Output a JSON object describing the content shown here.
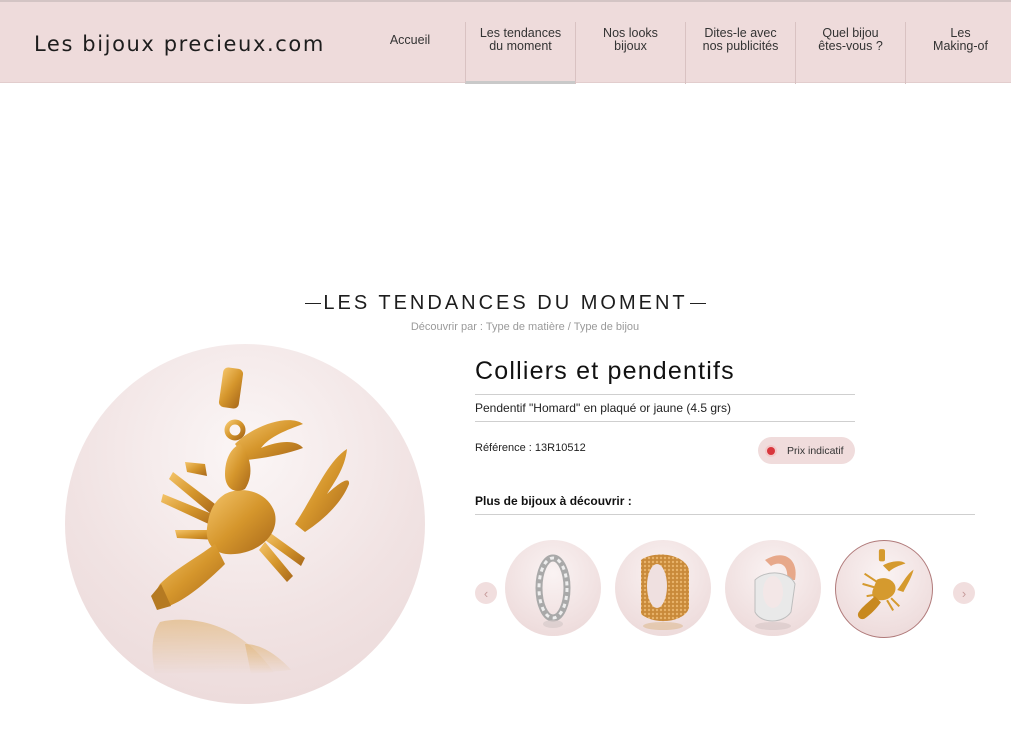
{
  "header": {
    "logo": "Les bijoux precieux.com",
    "nav": [
      {
        "line1": "Accueil",
        "line2": ""
      },
      {
        "line1": "Les tendances",
        "line2": "du moment"
      },
      {
        "line1": "Nos looks",
        "line2": "bijoux"
      },
      {
        "line1": "Dites-le avec",
        "line2": "nos publicités"
      },
      {
        "line1": "Quel bijou",
        "line2": "êtes-vous ?"
      },
      {
        "line1": "Les",
        "line2": "Making-of"
      }
    ]
  },
  "section": {
    "title": "LES TENDANCES DU MOMENT",
    "filter_prefix": "Découvrir par : ",
    "filter_material": "Type de matière",
    "filter_separator": " / ",
    "filter_type": "Type de bijou"
  },
  "product": {
    "category": "Colliers et pendentifs",
    "description": "Pendentif \"Homard\" en plaqué or jaune (4.5 grs)",
    "reference": "Référence : 13R10512",
    "price_button": "Prix indicatif"
  },
  "more": {
    "label": "Plus de bijoux à découvrir :",
    "prev_icon": "chevron-left-icon",
    "next_icon": "chevron-right-icon",
    "prev_glyph": "‹",
    "next_glyph": "›"
  },
  "colors": {
    "header_bg": "#eedbdb",
    "accent_pink": "#f0dcdc",
    "status_dot": "#d8373d",
    "gold": "#d59a2e"
  }
}
